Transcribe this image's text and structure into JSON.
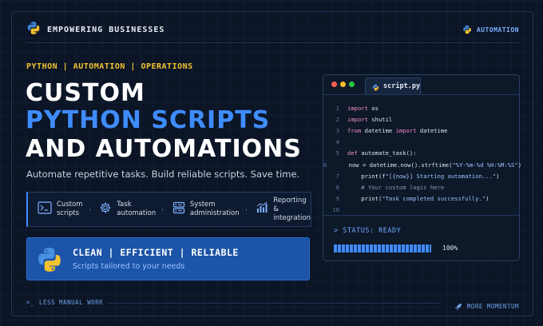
{
  "brand": {
    "title": "EMPOWERING BUSINESSES",
    "logo": "python-logo-icon"
  },
  "badge": {
    "label": "AUTOMATION",
    "icon": "python-logo-icon"
  },
  "tagline": "PYTHON | AUTOMATION | OPERATIONS",
  "headline": {
    "line1": "CUSTOM",
    "line2": "PYTHON SCRIPTS",
    "line3": "AND AUTOMATIONS"
  },
  "subheading": "Automate repetitive tasks. Build reliable scripts. Save time.",
  "features": [
    {
      "icon": "terminal-icon",
      "line1": "Custom",
      "line2": "scripts"
    },
    {
      "icon": "gear-icon",
      "line1": "Task",
      "line2": "automation"
    },
    {
      "icon": "server-icon",
      "line1": "System",
      "line2": "administration"
    },
    {
      "icon": "bar-chart-icon",
      "line1": "Reporting &",
      "line2": "integration"
    }
  ],
  "callout": {
    "title": "CLEAN | EFFICIENT | RELIABLE",
    "subtitle": "Scripts tailored to your needs",
    "icon": "python-logo-icon"
  },
  "editor": {
    "tab_label": "script.py",
    "line_numbers": [
      "1",
      "2",
      "3",
      "4",
      "5",
      "6",
      "7",
      "8",
      "9",
      "10"
    ],
    "code": {
      "l1_kw": "import",
      "l1_tx": " os",
      "l2_kw": "import",
      "l2_tx": " shutil",
      "l3_kw": "from",
      "l3_tx1": " datetime ",
      "l3_kw2": "import",
      "l3_tx2": " datetime",
      "l5_kw": "def",
      "l5_tx": " automate_task():",
      "l6_tx": "    now = datetime.now().strftime(",
      "l6_st": "\"%Y-%m-%d %H:%M:%S\"",
      "l6_tx2": ")",
      "l7_tx": "    print(f",
      "l7_st": "\"[{now}] Starting automation...\"",
      "l7_tx2": ")",
      "l8_cm": "    # Your custom logic here",
      "l9_tx": "    print(",
      "l9_st": "\"Task completed successfully.\"",
      "l9_tx2": ")"
    },
    "status": "> STATUS: READY",
    "progress_percent": 100,
    "progress_label": "100%",
    "window_dots": [
      "#ff5f56",
      "#ffbd2e",
      "#27c93f"
    ]
  },
  "footer": {
    "left": "LESS MANUAL WORK",
    "left_icon": "prompt-icon",
    "right": "MORE MOMENTUM",
    "right_icon": "rocket-icon"
  },
  "colors": {
    "accent": "#3f8cff",
    "tagline": "#f2c230",
    "background": "#0b1526"
  }
}
